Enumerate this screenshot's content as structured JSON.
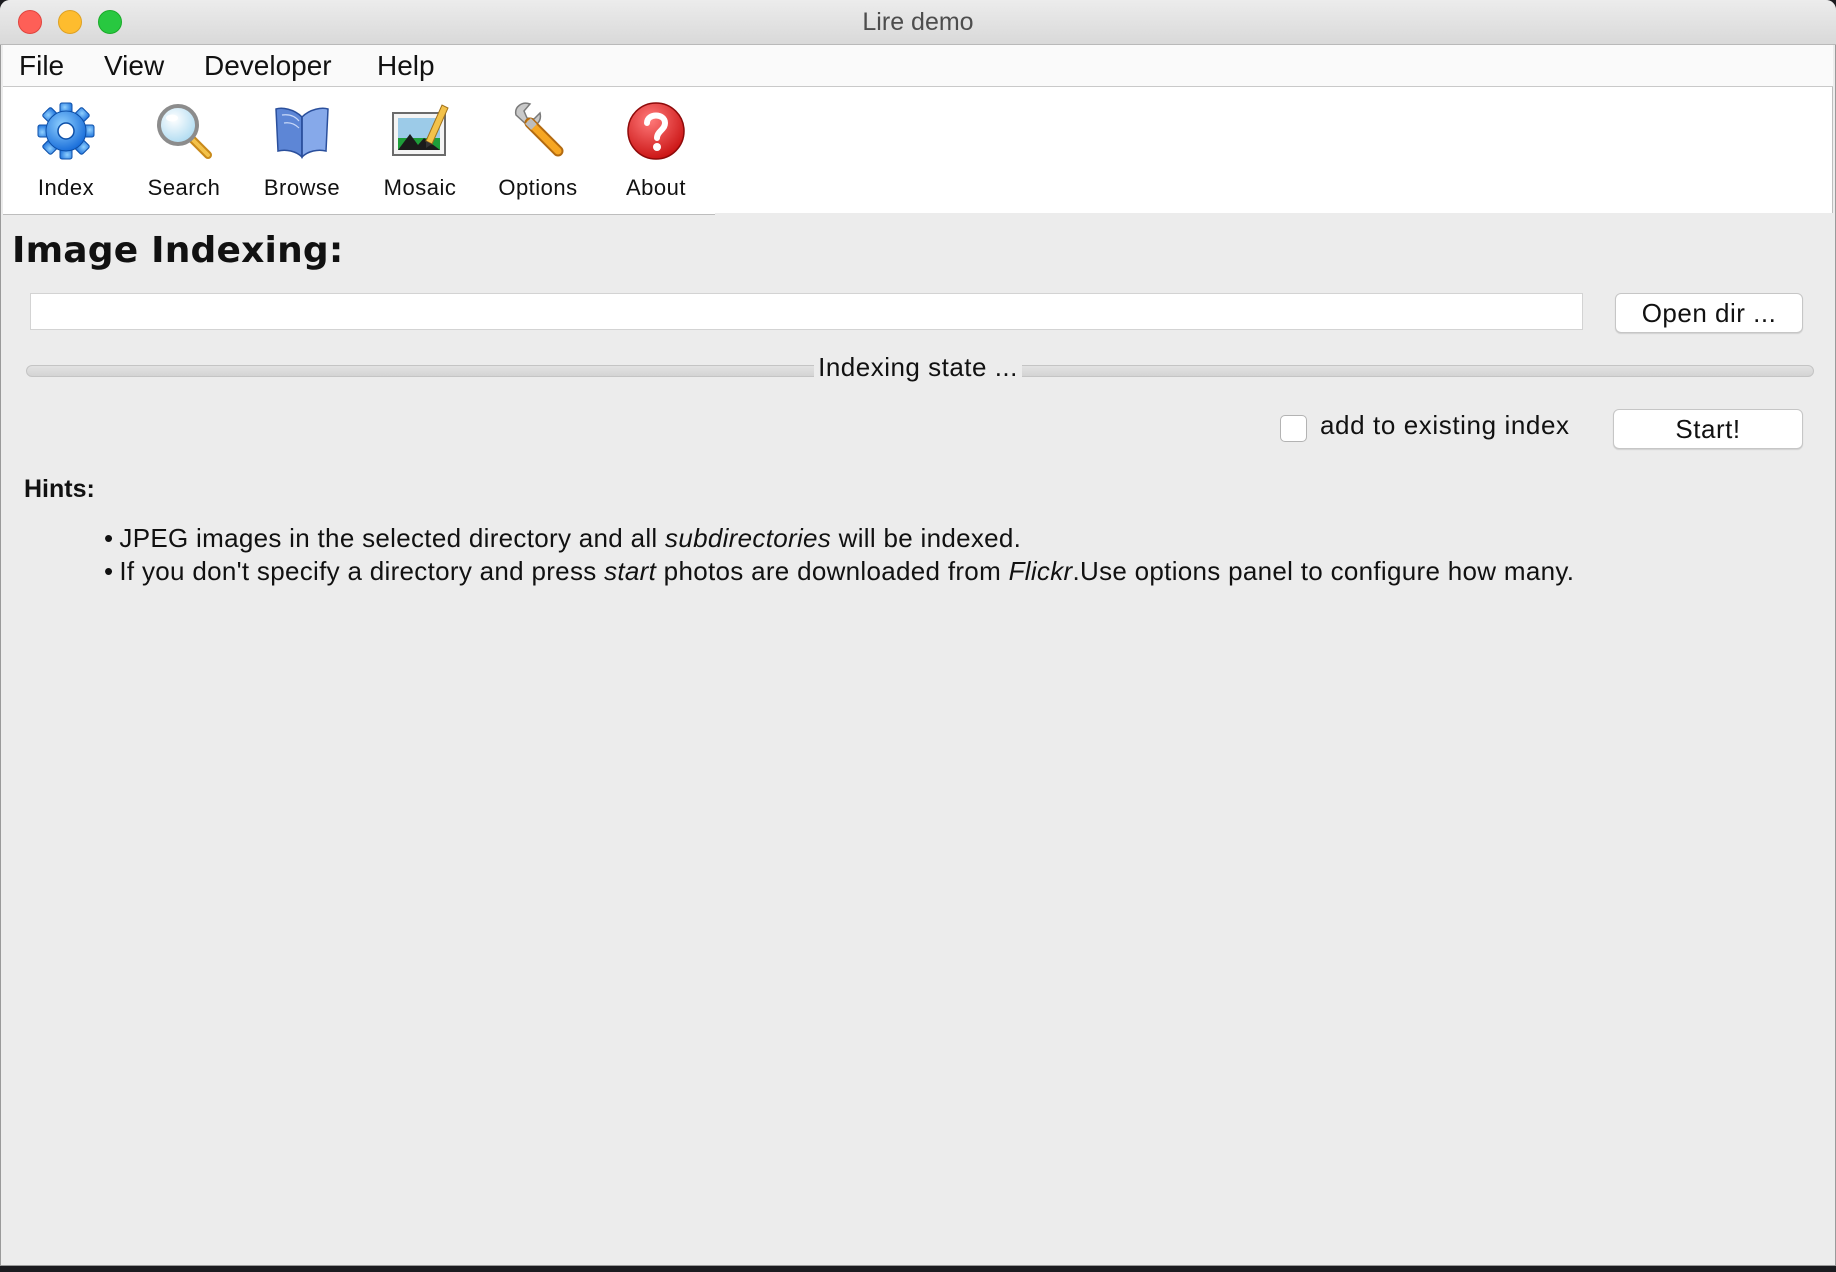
{
  "window": {
    "title": "Lire demo",
    "controls": {
      "close": "#fe5f57",
      "minimize": "#febc2e",
      "maximize": "#28c840"
    }
  },
  "menu": [
    "File",
    "View",
    "Developer",
    "Help"
  ],
  "toolbar": [
    {
      "label": "Index",
      "icon": "gear-icon"
    },
    {
      "label": "Search",
      "icon": "magnifier-icon"
    },
    {
      "label": "Browse",
      "icon": "book-icon"
    },
    {
      "label": "Mosaic",
      "icon": "picture-pencil-icon"
    },
    {
      "label": "Options",
      "icon": "wrench-icon"
    },
    {
      "label": "About",
      "icon": "question-icon"
    }
  ],
  "indexing": {
    "title": "Image Indexing:",
    "directory_value": "",
    "open_dir_label": "Open dir ...",
    "progress_text": "Indexing state ...",
    "progress_value": 0,
    "add_existing_label": "add to existing index",
    "add_existing_checked": false,
    "start_label": "Start!"
  },
  "hints": {
    "title": "Hints:",
    "bullet": "•",
    "items": [
      [
        {
          "text": "JPEG images in the selected directory and all "
        },
        {
          "text": "subdirectories",
          "italic": true
        },
        {
          "text": " will be indexed."
        }
      ],
      [
        {
          "text": "If you don't specify a directory and press "
        },
        {
          "text": "start",
          "italic": true
        },
        {
          "text": " photos are downloaded from "
        },
        {
          "text": "Flickr",
          "italic": true
        },
        {
          "text": ".Use options panel to configure how many."
        }
      ]
    ]
  },
  "colors": {
    "window_bg": "#ececec",
    "accent": "#5b9bf0",
    "about_red": "#e11c1c"
  }
}
